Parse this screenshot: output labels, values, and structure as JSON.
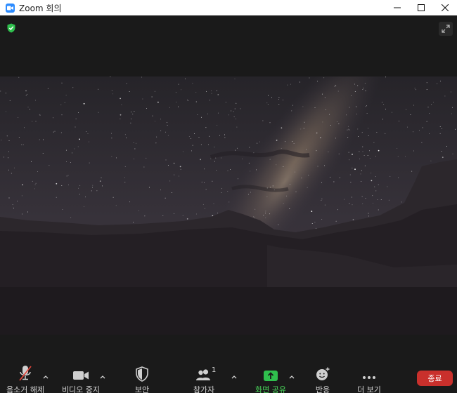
{
  "window": {
    "title": "Zoom 회의"
  },
  "toolbar": {
    "unmute_label": "음소거 해제",
    "stop_video_label": "비디오 중지",
    "security_label": "보안",
    "participants_label": "참가자",
    "participants_count": "1",
    "share_screen_label": "화면 공유",
    "reactions_label": "반응",
    "more_label": "더 보기",
    "end_label": "종료"
  },
  "colors": {
    "accent_green": "#4ad95a",
    "end_red": "#c9302c",
    "mute_slash": "#e0463b",
    "background": "#1a1a1a"
  },
  "icons": {
    "app": "zoom-logo-icon",
    "encryption": "shield-check-icon",
    "fullscreen": "expand-icon",
    "mic": "microphone-muted-icon",
    "video": "video-camera-icon",
    "security": "security-shield-icon",
    "participants": "people-icon",
    "share": "share-screen-arrow-icon",
    "reactions": "emoji-add-icon",
    "more": "ellipsis-icon"
  }
}
